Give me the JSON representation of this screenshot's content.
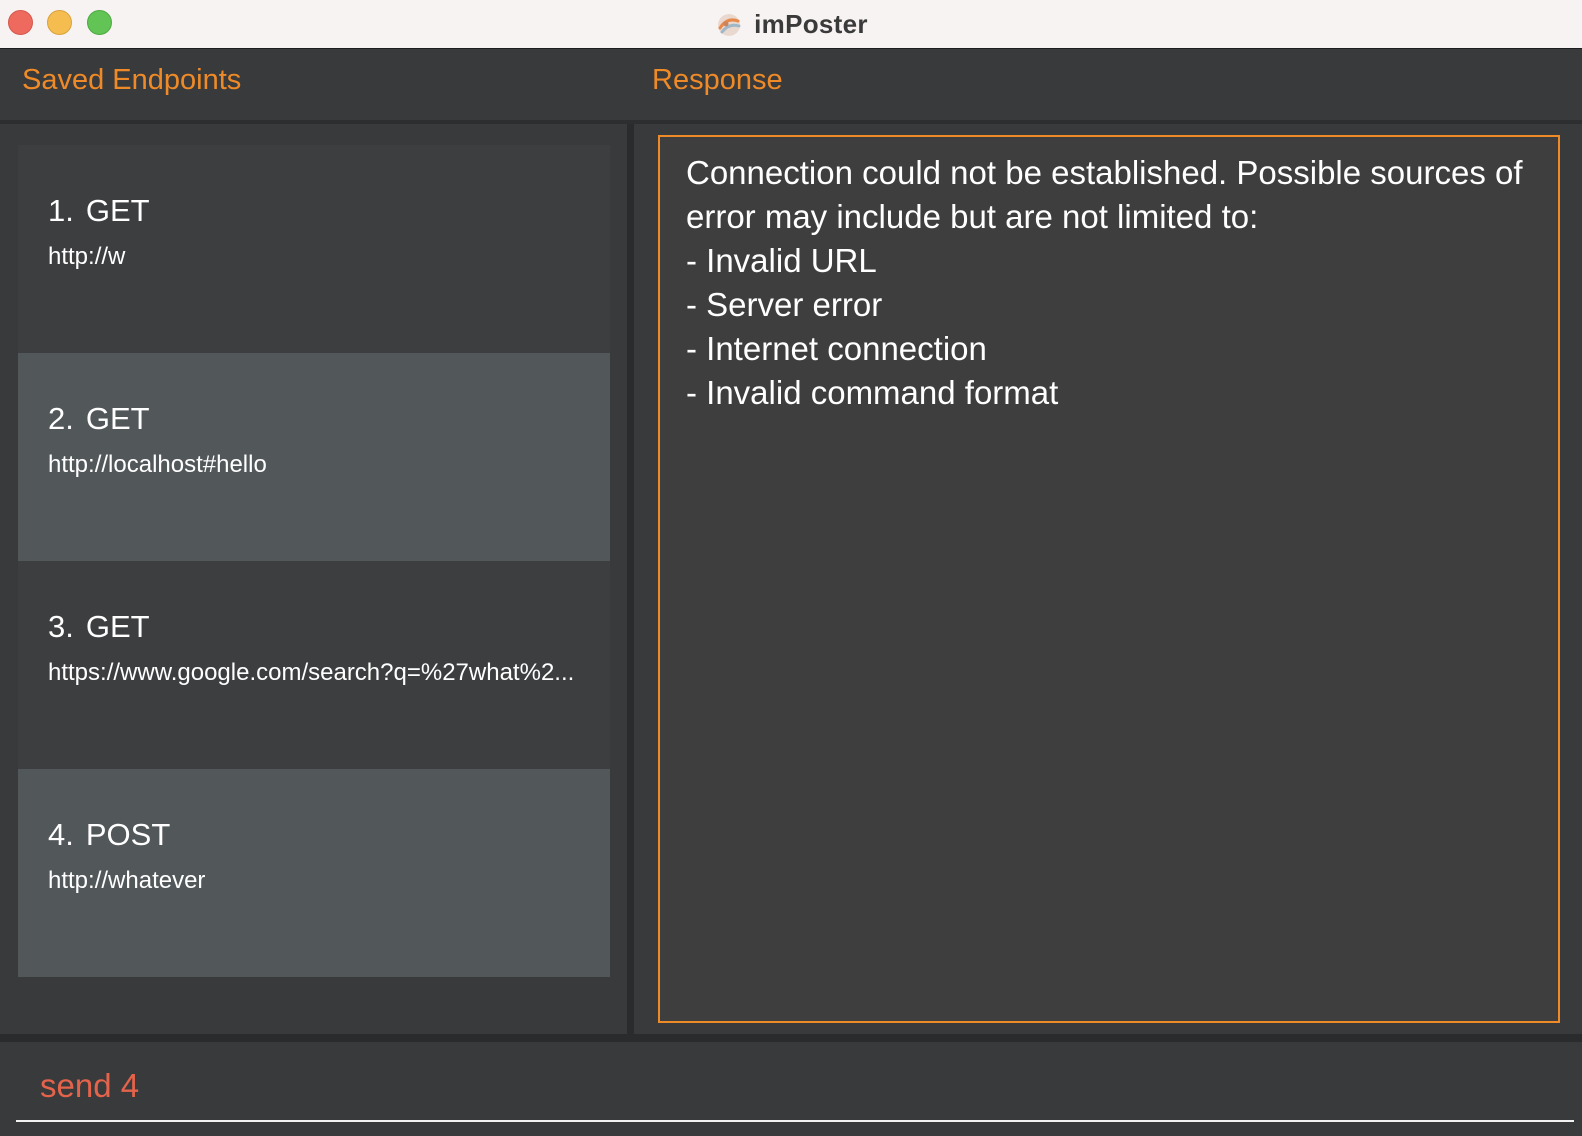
{
  "window": {
    "title": "imPoster"
  },
  "headers": {
    "left": "Saved Endpoints",
    "right": "Response"
  },
  "endpoints": [
    {
      "index": "1.",
      "method": "GET",
      "url": "http://w"
    },
    {
      "index": "2.",
      "method": "GET",
      "url": "http://localhost#hello"
    },
    {
      "index": "3.",
      "method": "GET",
      "url": "https://www.google.com/search?q=%27what%2..."
    },
    {
      "index": "4.",
      "method": "POST",
      "url": "http://whatever"
    }
  ],
  "response": {
    "lines": [
      "Connection could not be established. Possible sources of",
      "error may include but are not limited to:",
      "- Invalid URL",
      "- Server error",
      "- Internet connection",
      "- Invalid command format"
    ]
  },
  "command": {
    "value": "send 4"
  },
  "colors": {
    "accent": "#ee8a27",
    "command_text": "#e4634b",
    "background": "#393a3c",
    "item_light": "#52575a",
    "item_dark": "#3d3e40"
  }
}
